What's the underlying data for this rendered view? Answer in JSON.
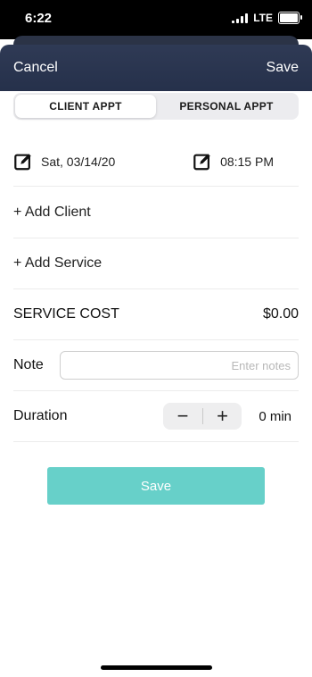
{
  "status_bar": {
    "time": "6:22",
    "network": "LTE",
    "icons": [
      "signal-icon",
      "battery-icon"
    ]
  },
  "header": {
    "cancel_label": "Cancel",
    "save_label": "Save"
  },
  "segments": {
    "client": "CLIENT APPT",
    "personal": "PERSONAL APPT",
    "selected": "CLIENT APPT"
  },
  "appointment": {
    "date": "Sat, 03/14/20",
    "time": "08:15 PM",
    "edit_icon": "edit-square-icon"
  },
  "actions": {
    "add_client": "+ Add Client",
    "add_service": "+ Add Service"
  },
  "cost": {
    "label": "SERVICE COST",
    "value": "$0.00"
  },
  "note": {
    "label": "Note",
    "placeholder": "Enter notes",
    "value": ""
  },
  "duration": {
    "label": "Duration",
    "minus": "−",
    "plus": "+",
    "value": "0 min"
  },
  "footer": {
    "save_label": "Save"
  },
  "colors": {
    "header_bg": "#2f3a55",
    "save_button": "#67d0c9"
  }
}
